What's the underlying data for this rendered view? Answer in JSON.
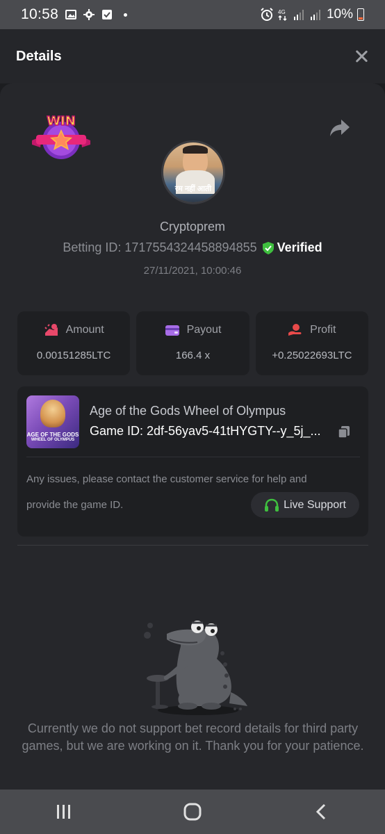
{
  "status_bar": {
    "time": "10:58",
    "battery": "10%"
  },
  "header": {
    "title": "Details"
  },
  "user": {
    "name": "Cryptoprem",
    "avatar_caption": "रम नहीं आती",
    "betting_id_label": "Betting ID: 1717554324458894855",
    "verified": "Verified",
    "date": "27/11/2021, 10:00:46"
  },
  "stats": [
    {
      "label": "Amount",
      "value": "0.00151285LTC",
      "icon": "amount-icon",
      "color": "#e8486a"
    },
    {
      "label": "Payout",
      "value": "166.4 x",
      "icon": "payout-icon",
      "color": "#a86de8"
    },
    {
      "label": "Profit",
      "value": "+0.25022693LTC",
      "icon": "profit-icon",
      "color": "#e84a4a"
    }
  ],
  "game": {
    "title": "Age of the Gods Wheel of Olympus",
    "game_id": "Game ID: 2df-56yav5-41tHYGTY--y_5j_...",
    "thumb_text_1": "AGE OF THE GODS",
    "thumb_text_2": "WHEEL OF OLYMPUS",
    "issues_line_1": "Any issues, please contact the customer service for help and",
    "issues_line_2": "provide the game ID.",
    "support_label": "Live Support"
  },
  "empty_message": "Currently we do not support bet record details for third party games, but we are working on it. Thank you for your patience.",
  "badge_text": "WIN",
  "colors": {
    "accent_green": "#3fbf3f",
    "bg": "#1c1d20",
    "panel": "#26272b",
    "card": "#1e1f22"
  }
}
